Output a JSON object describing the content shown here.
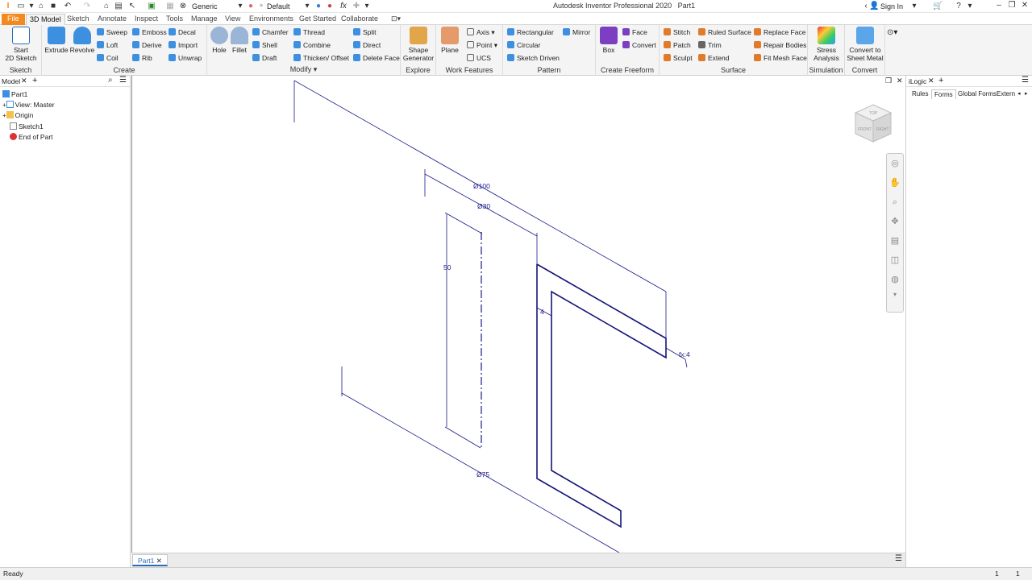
{
  "qat": {
    "material": "Generic",
    "appearance": "Default",
    "title": "Autodesk Inventor Professional 2020",
    "doc": "Part1",
    "sign_in": "Sign In"
  },
  "tabs": [
    "File",
    "3D Model",
    "Sketch",
    "Annotate",
    "Inspect",
    "Tools",
    "Manage",
    "View",
    "Environments",
    "Get Started",
    "Collaborate"
  ],
  "ribbon": {
    "sketch": {
      "title": "Sketch",
      "start": "Start",
      "sketch2d": "2D Sketch"
    },
    "create": {
      "title": "Create",
      "extrude": "Extrude",
      "revolve": "Revolve",
      "sweep": "Sweep",
      "loft": "Loft",
      "coil": "Coil",
      "emboss": "Emboss",
      "derive": "Derive",
      "rib": "Rib",
      "decal": "Decal",
      "import": "Import",
      "unwrap": "Unwrap"
    },
    "modify": {
      "title": "Modify",
      "hole": "Hole",
      "fillet": "Fillet",
      "chamfer": "Chamfer",
      "shell": "Shell",
      "draft": "Draft",
      "thread": "Thread",
      "combine": "Combine",
      "thicken": "Thicken/ Offset",
      "split": "Split",
      "direct": "Direct",
      "delete_face": "Delete Face"
    },
    "explore": {
      "title": "Explore",
      "shape1": "Shape",
      "shape2": "Generator"
    },
    "work": {
      "title": "Work Features",
      "plane": "Plane",
      "axis": "Axis",
      "point": "Point",
      "ucs": "UCS"
    },
    "pattern": {
      "title": "Pattern",
      "rectangular": "Rectangular",
      "circular": "Circular",
      "sketch_driven": "Sketch Driven",
      "mirror": "Mirror"
    },
    "freeform": {
      "title": "Create Freeform",
      "box": "Box",
      "face": "Face",
      "convert": "Convert"
    },
    "surface": {
      "title": "Surface",
      "stitch": "Stitch",
      "patch": "Patch",
      "sculpt": "Sculpt",
      "ruled": "Ruled Surface",
      "trim": "Trim",
      "extend": "Extend",
      "replace": "Replace Face",
      "repair": "Repair Bodies",
      "fitmesh": "Fit Mesh Face"
    },
    "simulation": {
      "title": "Simulation",
      "stress1": "Stress",
      "stress2": "Analysis"
    },
    "convert": {
      "title": "Convert",
      "sm1": "Convert to",
      "sm2": "Sheet Metal"
    }
  },
  "browser": {
    "tab": "Model",
    "items": [
      "Part1",
      "View: Master",
      "Origin",
      "Sketch1",
      "End of Part"
    ]
  },
  "sketch": {
    "dim_100": "Ø100",
    "dim_30": "Ø30",
    "dim_50": "50",
    "dim_4": "4",
    "dim_75": "Ø75",
    "dim_fx4": "fx:4"
  },
  "viewcube": {
    "top": "TOP",
    "front": "FRONT",
    "right": "RIGHT"
  },
  "doctab": "Part1",
  "ilogic": {
    "title": "iLogic",
    "tabs": [
      "Rules",
      "Forms",
      "Global Forms",
      "Extern"
    ]
  },
  "status": {
    "text": "Ready",
    "n1": "1",
    "n2": "1"
  }
}
